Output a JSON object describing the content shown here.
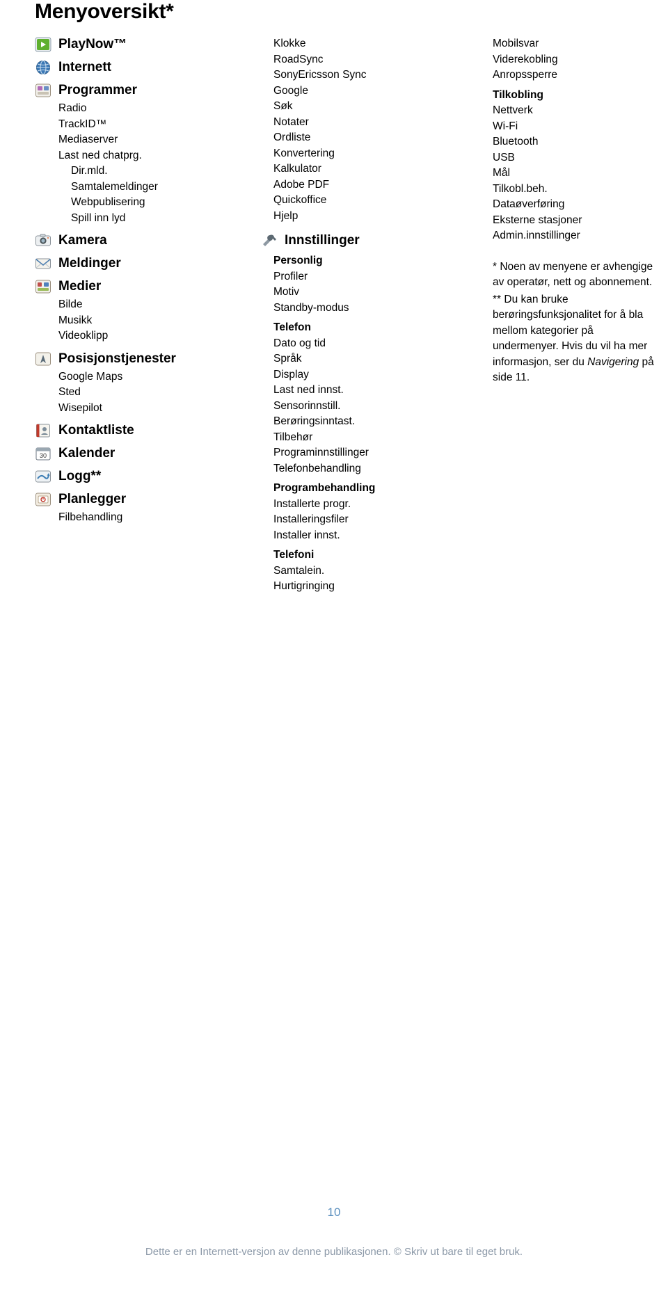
{
  "page": {
    "title": "Menyoversikt*",
    "page_number": "10",
    "footer": "Dette er en Internett-versjon av denne publikasjonen. © Skriv ut bare til eget bruk."
  },
  "column1": [
    {
      "type": "cat",
      "icon": "playnow-icon",
      "label": "PlayNow™"
    },
    {
      "type": "cat",
      "icon": "internet-globe-icon",
      "label": "Internett"
    },
    {
      "type": "cat",
      "icon": "programs-icon",
      "label": "Programmer"
    },
    {
      "type": "sub",
      "label": "Radio"
    },
    {
      "type": "sub",
      "label": "TrackID™"
    },
    {
      "type": "sub",
      "label": "Mediaserver"
    },
    {
      "type": "sub",
      "label": "Last ned chatprg."
    },
    {
      "type": "sub",
      "label": "Dir.mld."
    },
    {
      "type": "sub",
      "label": "Samtalemeldinger"
    },
    {
      "type": "sub",
      "label": "Webpublisering"
    },
    {
      "type": "sub",
      "label": "Spill inn lyd"
    },
    {
      "type": "cat",
      "icon": "camera-icon",
      "label": "Kamera"
    },
    {
      "type": "cat",
      "icon": "messaging-envelope-icon",
      "label": "Meldinger"
    },
    {
      "type": "cat",
      "icon": "media-icon",
      "label": "Medier"
    },
    {
      "type": "sub",
      "label": "Bilde"
    },
    {
      "type": "sub",
      "label": "Musikk"
    },
    {
      "type": "sub",
      "label": "Videoklipp"
    },
    {
      "type": "cat",
      "icon": "location-services-icon",
      "label": "Posisjonstjenester"
    },
    {
      "type": "sub",
      "label": "Google Maps"
    },
    {
      "type": "sub",
      "label": "Sted"
    },
    {
      "type": "sub",
      "label": "Wisepilot"
    },
    {
      "type": "cat",
      "icon": "contacts-icon",
      "label": "Kontaktliste"
    },
    {
      "type": "cat",
      "icon": "calendar-icon",
      "label": "Kalender"
    },
    {
      "type": "cat",
      "icon": "call-log-icon",
      "label": "Logg**"
    },
    {
      "type": "cat",
      "icon": "organizer-icon",
      "label": "Planlegger"
    },
    {
      "type": "sub",
      "label": "Filbehandling"
    }
  ],
  "column2": {
    "top_list": [
      "Klokke",
      "RoadSync",
      "SonyEricsson Sync",
      "Google",
      "Søk",
      "Notater",
      "Ordliste",
      "Konvertering",
      "Kalkulator",
      "Adobe PDF",
      "Quickoffice",
      "Hjelp"
    ],
    "settings_section": {
      "icon": "settings-tools-icon",
      "label": "Innstillinger",
      "groups": [
        {
          "head": "Personlig",
          "items": [
            "Profiler",
            "Motiv",
            "Standby-modus"
          ]
        },
        {
          "head": "Telefon",
          "items": [
            "Dato og tid",
            "Språk",
            "Display",
            "Last ned innst.",
            "Sensorinnstill.",
            "Berøringsinntast.",
            "Tilbehør",
            "Programinnstillinger",
            "Telefonbehandling"
          ]
        },
        {
          "head": "Programbehandling",
          "items": [
            "Installerte progr.",
            "Installeringsfiler",
            "Installer innst."
          ]
        },
        {
          "head": "Telefoni",
          "items": [
            "Samtalein.",
            "Hurtigringing"
          ]
        }
      ]
    }
  },
  "column3": {
    "top_list": [
      "Mobilsvar",
      "Viderekobling",
      "Anropssperre"
    ],
    "groups": [
      {
        "head": "Tilkobling",
        "items": [
          "Nettverk",
          "Wi-Fi",
          "Bluetooth",
          "USB",
          "Mål",
          "Tilkobl.beh.",
          "Dataøverføring",
          "Eksterne stasjoner",
          "Admin.innstillinger"
        ]
      }
    ],
    "notes": [
      {
        "lead": "* Noen av menyene er avhengige av operatør, nett og abonnement."
      },
      {
        "lead": "** Du kan bruke berøringsfunksjonalitet for å bla mellom kategorier på undermenyer. Hvis du vil ha mer informasjon, ser du ",
        "italic": "Navigering",
        "tail": " på side 11."
      }
    ]
  }
}
